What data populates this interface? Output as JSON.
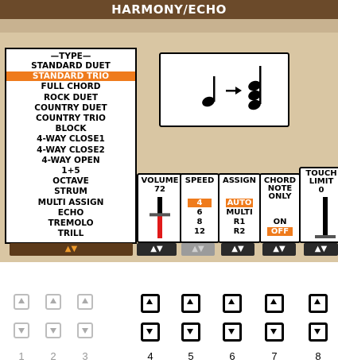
{
  "title": "HARMONY/ECHO",
  "type_panel": {
    "header": "TYPE",
    "items": [
      "STANDARD DUET",
      "STANDARD TRIO",
      "FULL CHORD",
      "ROCK DUET",
      "COUNTRY DUET",
      "COUNTRY TRIO",
      "BLOCK",
      "4-WAY CLOSE1",
      "4-WAY CLOSE2",
      "4-WAY OPEN",
      "1+5",
      "OCTAVE",
      "STRUM",
      "MULTI ASSIGN",
      "ECHO",
      "TREMOLO",
      "TRILL"
    ],
    "selected": "STANDARD TRIO"
  },
  "volume": {
    "header": "VOLUME",
    "value": "72",
    "level": 0.57
  },
  "speed": {
    "header": "SPEED",
    "items": [
      "4",
      "6",
      "8",
      "12"
    ],
    "selected": "4"
  },
  "assign": {
    "header": "ASSIGN",
    "items": [
      "AUTO",
      "MULTI",
      "R1",
      "R2"
    ],
    "selected": "AUTO"
  },
  "chord_note_only": {
    "header_line1": "CHORD",
    "header_line2": "NOTE",
    "header_line3": "ONLY",
    "items": [
      "ON",
      "OFF"
    ],
    "selected": "OFF"
  },
  "touch_limit": {
    "header_line1": "TOUCH",
    "header_line2": "LIMIT",
    "value": "0"
  },
  "arrow_label": "▲▼",
  "hardware": {
    "numbers": [
      "1",
      "2",
      "3",
      "4",
      "5",
      "6",
      "7",
      "8"
    ],
    "active": [
      false,
      false,
      false,
      true,
      true,
      true,
      true,
      true
    ]
  },
  "colors": {
    "accent": "#ef7b1c",
    "screen": "#d9c6a3",
    "title_bar": "#6b4a2a"
  }
}
